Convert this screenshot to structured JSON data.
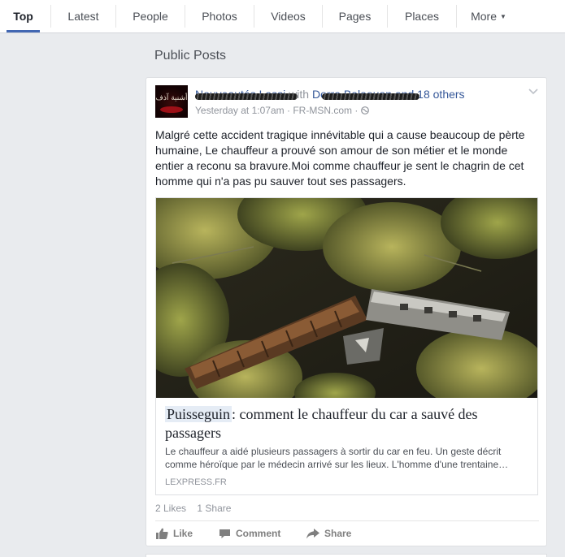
{
  "tabs": [
    {
      "label": "Top",
      "active": true
    },
    {
      "label": "Latest"
    },
    {
      "label": "People"
    },
    {
      "label": "Photos"
    },
    {
      "label": "Videos"
    },
    {
      "label": "Pages"
    },
    {
      "label": "Places"
    },
    {
      "label": "More"
    }
  ],
  "section_title": "Public Posts",
  "post": {
    "author_name": "Nouveautés Lassi",
    "with_text": "with",
    "tagged_name": "Dorra Balaouan",
    "others_text": "and 18 others",
    "timestamp": "Yesterday at 1:07am",
    "via": "FR-MSN.com",
    "separator": "·",
    "avatar_text": "أشنية آذف",
    "text": "Malgré cette accident tragique innévitable qui a cause beaucoup de pèrte humaine, Le chauffeur a prouvé son amour de son métier et le monde entier a reconu sa bravure.Moi comme chauffeur je sent le chagrin de cet homme qui n'a pas pu sauver tout ses passagers.",
    "link": {
      "title_highlight": "Puisseguin",
      "title_rest": ": comment le chauffeur du car a sauvé des passagers",
      "description": "Le chauffeur a aidé plusieurs passagers à sortir du car en feu. Un geste décrit comme héroïque par le médecin arrivé sur les lieux. L'homme d'une trentaine…",
      "source": "LEXPRESS.FR"
    },
    "likes": "2 Likes",
    "shares": "1 Share",
    "actions": {
      "like": "Like",
      "comment": "Comment",
      "share": "Share"
    }
  },
  "colors": {
    "link_blue": "#365899",
    "tab_underline": "#4267b2",
    "page_bg": "#e9ebee"
  }
}
